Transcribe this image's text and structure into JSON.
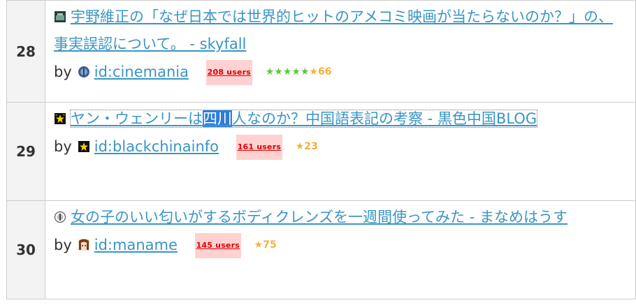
{
  "entries": [
    {
      "rank": "28",
      "title": "宇野維正の「なぜ日本では世界的ヒットのアメコミ映画が当たらないのか？」の、事実誤認について。 - skyfall",
      "by": "by",
      "user": "id:cinemania",
      "users": "208 users",
      "stars_green": "★★★★★",
      "stars_yellow": "★66"
    },
    {
      "rank": "29",
      "title_before": "ヤン・ウェンリーは",
      "title_selected": "四川",
      "title_after": "人なのか？中国語表記の考察 - 黒色中国BLOG",
      "by": "by",
      "user": "id:blackchinainfo",
      "users": "161 users",
      "stars_yellow": "★23"
    },
    {
      "rank": "30",
      "title": "女の子のいい匂いがするボディクレンズを一週間使ってみた - まなめはうす",
      "by": "by",
      "user": "id:maname",
      "users": "145 users",
      "stars_yellow": "★75"
    }
  ],
  "icons": {
    "entry28_favicon": "skyfall-favicon-icon",
    "entry29_favicon": "star-night-favicon-icon",
    "entry30_favicon": "circle-favicon-icon"
  },
  "colors": {
    "link": "#3a95c4",
    "selection": "#2f7dd8",
    "users_badge_text": "#dd0000",
    "users_badge_bg": "#ffd1d1",
    "star_yellow": "#f2b13b",
    "star_green": "#5cc83b"
  }
}
